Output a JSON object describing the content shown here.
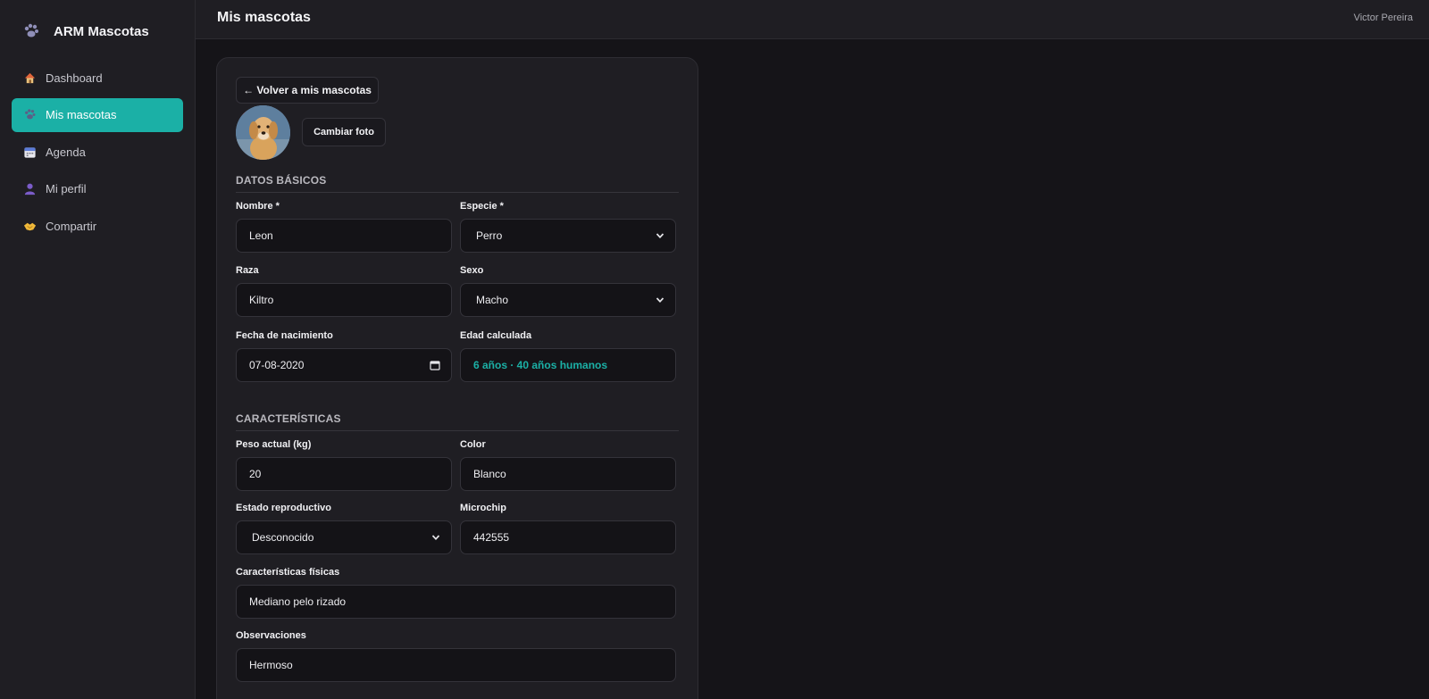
{
  "app": {
    "title": "ARM Mascotas",
    "icon": "paw-icon"
  },
  "sidebar": {
    "items": [
      {
        "label": "Dashboard",
        "icon": "house-icon",
        "active": false
      },
      {
        "label": "Mis mascotas",
        "icon": "paw-icon",
        "active": true
      },
      {
        "label": "Agenda",
        "icon": "calendar-icon",
        "active": false
      },
      {
        "label": "Mi perfil",
        "icon": "user-icon",
        "active": false
      },
      {
        "label": "Compartir",
        "icon": "handshake-icon",
        "active": false
      }
    ]
  },
  "header": {
    "title": "Mis mascotas",
    "user": "Victor Pereira"
  },
  "card": {
    "back_label": "← Volver a mis mascotas",
    "change_photo_label": "Cambiar foto",
    "sections": {
      "basic": "DATOS BÁSICOS",
      "characteristics": "CARACTERÍSTICAS"
    },
    "fields": {
      "name": {
        "label": "Nombre *",
        "value": "Leon"
      },
      "species": {
        "label": "Especie *",
        "value": "Perro"
      },
      "breed": {
        "label": "Raza",
        "value": "Kiltro"
      },
      "sex": {
        "label": "Sexo",
        "value": "Macho"
      },
      "birthdate": {
        "label": "Fecha de nacimiento",
        "value": "07-08-2020"
      },
      "age": {
        "label": "Edad calculada",
        "value": "6 años · 40 años humanos"
      },
      "weight": {
        "label": "Peso actual (kg)",
        "value": "20"
      },
      "color": {
        "label": "Color",
        "value": "Blanco"
      },
      "reproductive": {
        "label": "Estado reproductivo",
        "value": "Desconocido"
      },
      "microchip": {
        "label": "Microchip",
        "value": "442555"
      },
      "physical": {
        "label": "Características físicas",
        "value": "Mediano pelo rizado"
      },
      "notes": {
        "label": "Observaciones",
        "value": "Hermoso"
      }
    }
  },
  "colors": {
    "accent": "#1bb0a6",
    "background": "#151418",
    "panel": "#1f1e23"
  }
}
